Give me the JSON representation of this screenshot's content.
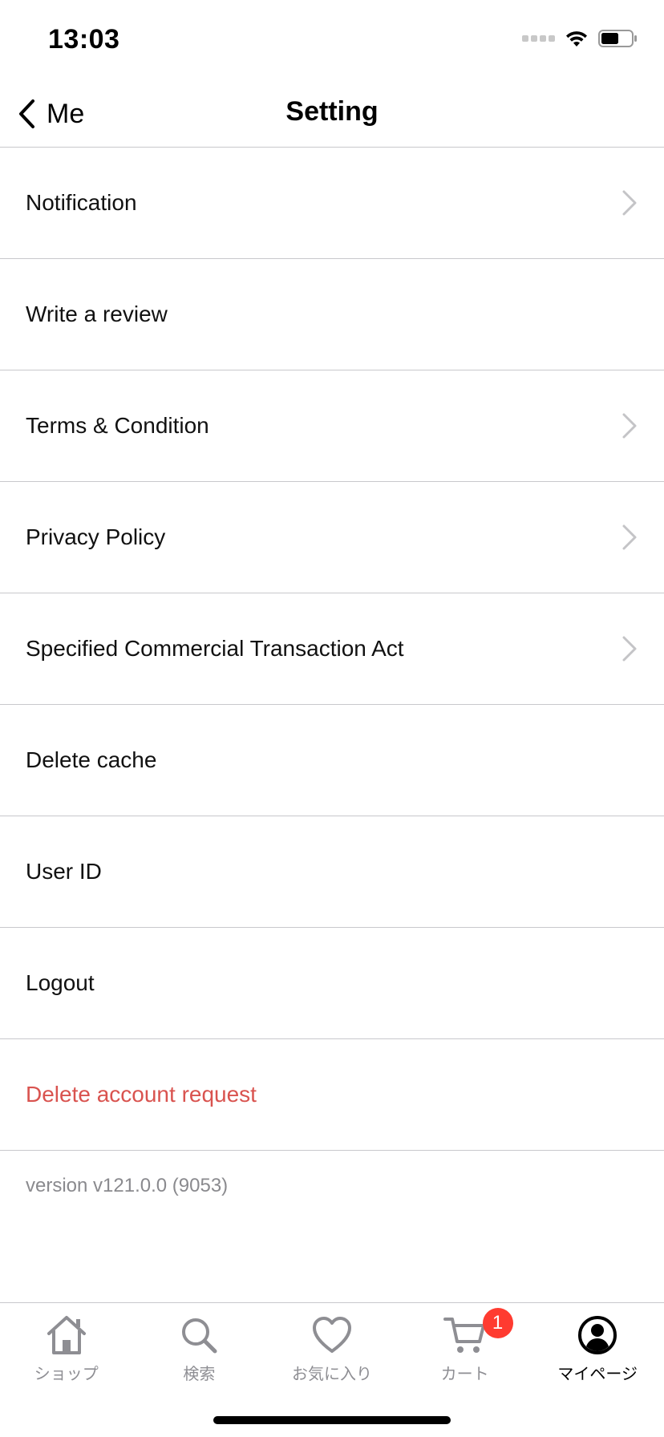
{
  "status_bar": {
    "time": "13:03"
  },
  "nav": {
    "back_label": "Me",
    "title": "Setting"
  },
  "settings": {
    "items": [
      {
        "label": "Notification",
        "has_chevron": true
      },
      {
        "label": "Write a review",
        "has_chevron": false
      },
      {
        "label": "Terms & Condition",
        "has_chevron": true
      },
      {
        "label": "Privacy Policy",
        "has_chevron": true
      },
      {
        "label": "Specified Commercial Transaction Act",
        "has_chevron": true
      },
      {
        "label": "Delete cache",
        "has_chevron": false
      },
      {
        "label": "User ID",
        "has_chevron": false
      },
      {
        "label": "Logout",
        "has_chevron": false
      },
      {
        "label": "Delete account request",
        "has_chevron": false,
        "color": "#d9534f"
      }
    ]
  },
  "version": "version v121.0.0 (9053)",
  "tab_bar": {
    "tabs": [
      {
        "label": "ショップ",
        "icon": "home-icon",
        "active": false
      },
      {
        "label": "検索",
        "icon": "search-icon",
        "active": false
      },
      {
        "label": "お気に入り",
        "icon": "heart-icon",
        "active": false
      },
      {
        "label": "カート",
        "icon": "cart-icon",
        "active": false,
        "badge": "1"
      },
      {
        "label": "マイページ",
        "icon": "profile-icon",
        "active": true
      }
    ],
    "badge_color": "#ff3b30",
    "inactive_color": "#8e8e93",
    "active_color": "#000000"
  }
}
